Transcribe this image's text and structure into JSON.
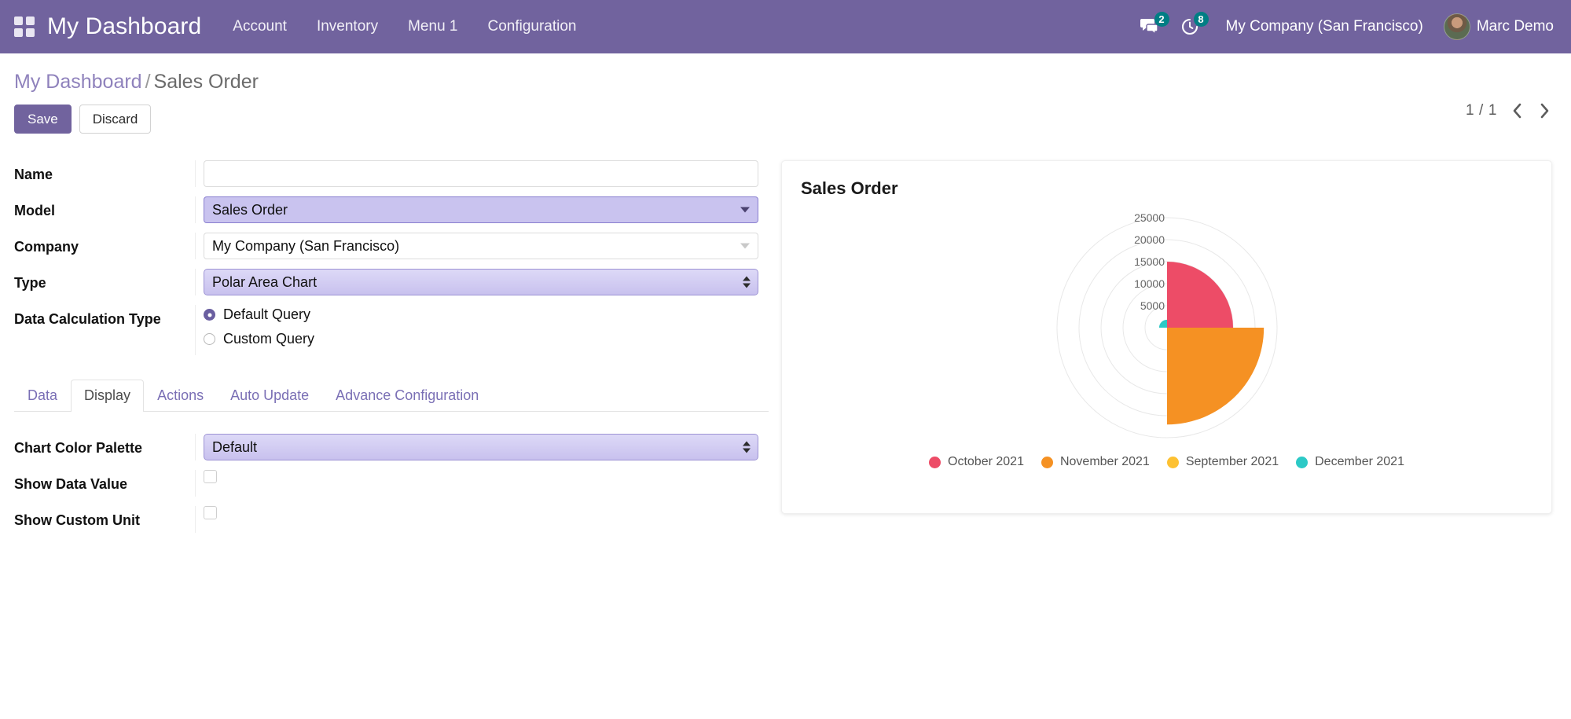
{
  "navbar": {
    "apps_icon": "grid-apps-icon",
    "brand": "My Dashboard",
    "menu": [
      {
        "label": "Account"
      },
      {
        "label": "Inventory"
      },
      {
        "label": "Menu 1"
      },
      {
        "label": "Configuration"
      }
    ],
    "messages_icon": "messages-icon",
    "messages_badge": "2",
    "activities_icon": "clock-activity-icon",
    "activities_badge": "8",
    "company": "My Company (San Francisco)",
    "user": "Marc Demo",
    "bg_color": "#71639e"
  },
  "control_panel": {
    "breadcrumb_root": "My Dashboard",
    "breadcrumb_sep": "/",
    "breadcrumb_current": "Sales Order",
    "save_label": "Save",
    "discard_label": "Discard",
    "pager_count": "1 / 1",
    "pager_prev_icon": "chevron-left-icon",
    "pager_next_icon": "chevron-right-icon"
  },
  "form": {
    "fields": {
      "name": {
        "label": "Name",
        "value": "",
        "placeholder": ""
      },
      "model": {
        "label": "Model",
        "value": "Sales Order"
      },
      "company": {
        "label": "Company",
        "value": "My Company (San Francisco)"
      },
      "type": {
        "label": "Type",
        "value": "Polar Area Chart"
      },
      "data_calculation_type": {
        "label": "Data Calculation Type",
        "options": [
          {
            "label": "Default Query",
            "selected": true
          },
          {
            "label": "Custom Query",
            "selected": false
          }
        ]
      }
    }
  },
  "notebook": {
    "tabs": [
      {
        "label": "Data",
        "active": false
      },
      {
        "label": "Display",
        "active": true
      },
      {
        "label": "Actions",
        "active": false
      },
      {
        "label": "Auto Update",
        "active": false
      },
      {
        "label": "Advance Configuration",
        "active": false
      }
    ],
    "display_pane": {
      "chart_color_palette": {
        "label": "Chart Color Palette",
        "value": "Default"
      },
      "show_data_value": {
        "label": "Show Data Value",
        "checked": false
      },
      "show_custom_unit": {
        "label": "Show Custom Unit",
        "checked": false
      }
    }
  },
  "chart_data": {
    "type": "pie",
    "subtype": "polar-area",
    "title": "Sales Order",
    "xlabel": "",
    "ylabel": "",
    "categories": [
      "October 2021",
      "November 2021",
      "September 2021",
      "December 2021"
    ],
    "values": [
      15000,
      22000,
      0,
      1800
    ],
    "colors": [
      "#ed4c67",
      "#f59123",
      "#fdc132",
      "#2cc9c6"
    ],
    "radial_ticks": [
      5000,
      10000,
      15000,
      20000,
      25000
    ],
    "radial_tick_labels": [
      "5000",
      "10000",
      "15000",
      "20000",
      "25000"
    ],
    "rlim": [
      0,
      25000
    ],
    "grid": true,
    "legend_position": "bottom",
    "legend": [
      {
        "name": "October 2021",
        "color": "#ed4c67"
      },
      {
        "name": "November 2021",
        "color": "#f59123"
      },
      {
        "name": "September 2021",
        "color": "#fdc132"
      },
      {
        "name": "December 2021",
        "color": "#2cc9c6"
      }
    ]
  }
}
